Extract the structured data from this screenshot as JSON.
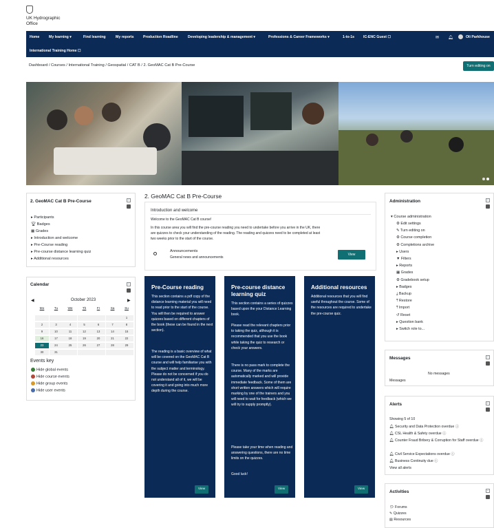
{
  "header": {
    "org_line1": "UK Hydrographic",
    "org_line2": "Office"
  },
  "nav": {
    "items": [
      "Home",
      "My learning ▾",
      "Find learning",
      "My reports",
      "Production Roadline",
      "Developing leadership & management ▾",
      "Professions & Career Frameworks ▾",
      "1-to-1s",
      "IC-ENC Guest ☐"
    ],
    "second_row": "International Training Home ☐",
    "user": "Oli Parkhouse"
  },
  "breadcrumb": "Dashboard / Courses / International Training / Geospatial / CAT B / 2. GeoMAC Cat B Pre-Course",
  "edit_button": "Turn editing on",
  "left_block": {
    "title": "2. GeoMAC Cat B Pre-Course",
    "items": [
      "Participants",
      "Badges",
      "Grades",
      "Introduction and welcome",
      "Pre-Course reading",
      "Pre-course distance learning quiz",
      "Additional resources"
    ]
  },
  "calendar": {
    "title": "Calendar",
    "month": "October 2023",
    "days": [
      "Mo",
      "Tu",
      "We",
      "Th",
      "Fr",
      "Sa",
      "Su"
    ],
    "weeks": [
      [
        "",
        "",
        "",
        "",
        "",
        "",
        "1"
      ],
      [
        "2",
        "3",
        "4",
        "5",
        "6",
        "7",
        "8"
      ],
      [
        "9",
        "10",
        "11",
        "12",
        "13",
        "14",
        "15"
      ],
      [
        "16",
        "17",
        "18",
        "19",
        "20",
        "21",
        "22"
      ],
      [
        "23",
        "24",
        "25",
        "26",
        "27",
        "28",
        "29"
      ],
      [
        "30",
        "31",
        "",
        "",
        "",
        "",
        ""
      ]
    ],
    "events_key": "Events key",
    "events": [
      "Hide global events",
      "Hide course events",
      "Hide group events",
      "Hide user events"
    ]
  },
  "main": {
    "title": "2. GeoMAC Cat B Pre-Course",
    "section_title": "Introduction and welcome",
    "welcome_line": "Welcome to the GeoMAC Cat B course!",
    "intro_1": "In this course area you will find the pre-course reading you need to undertake before you arrive in the UK, there",
    "intro_2": "are quizzes to check your understanding of the reading. The reading and quizzes need to be completed at least",
    "intro_3": "two weeks prior to the start of the course.",
    "announcements": "Announcements",
    "announcements_sub": "General news and announcements",
    "view": "View"
  },
  "cards": [
    {
      "title": "Pre-Course reading",
      "paras": [
        "This section contains a pdf copy of the distance learning material you will need to read prior to the start of the course. You will then be required to answer quizzes based on different chapters of the book (these can be found in the next section).",
        "The reading is a basic overview of what will be covered on the GeoMAC Cat B course and will help familiarise you with the subject matter and terminology. Please do not be concerned if you do not understand all of it, we will be covering it and going into much more depth during the course."
      ],
      "view": "View"
    },
    {
      "title": "Pre-course distance learning quiz",
      "paras": [
        "This section contains a series of quizzes based upon the your Distance Learning book.",
        "Please read the relevant chapters prior to taking the quiz, although it is recommended that you use the book while taking the quiz to research or check your answers.",
        "There is no pass mark to complete the course. Many of the marks are automatically marked and will provide immediate feedback. Some of them are short written answers which will require marking by one of the trainers and you will need to wait for feedback (which we will try to supply promptly).",
        "Please take your time when reading and answering questions, there are no time limits on the quizzes.",
        "Good luck!"
      ],
      "view": "View"
    },
    {
      "title": "Additional resources",
      "paras": [
        "Additional resources that you will find useful throughout the course. Some of the resources are required to undertake the pre-course quiz."
      ],
      "view": "View"
    }
  ],
  "admin": {
    "title": "Administration",
    "heading": "Course administration",
    "items": [
      "Edit settings",
      "Turn editing on",
      "Course completion",
      "Completions archive",
      "Users",
      "Filters",
      "Reports",
      "Grades",
      "Gradebook setup",
      "Badges",
      "Backup",
      "Restore",
      "Import",
      "Reset",
      "Question bank",
      "Switch role to..."
    ]
  },
  "messages": {
    "title": "Messages",
    "empty": "No messages",
    "link": "Messages"
  },
  "alerts": {
    "title": "Alerts",
    "showing": "Showing 5 of 10",
    "items": [
      "Security and Data Protection overdue",
      "CSL Health & Safety overdue",
      "Counter Fraud Bribery & Corruption for Staff overdue",
      "Civil Service Expectations overdue",
      "Business Continuity due"
    ],
    "view_all": "View all alerts"
  },
  "activities": {
    "title": "Activities",
    "items": [
      "Forums",
      "Quizzes",
      "Resources"
    ]
  },
  "colors": {
    "nav": "#0b2a55",
    "accent": "#0f6f73"
  }
}
